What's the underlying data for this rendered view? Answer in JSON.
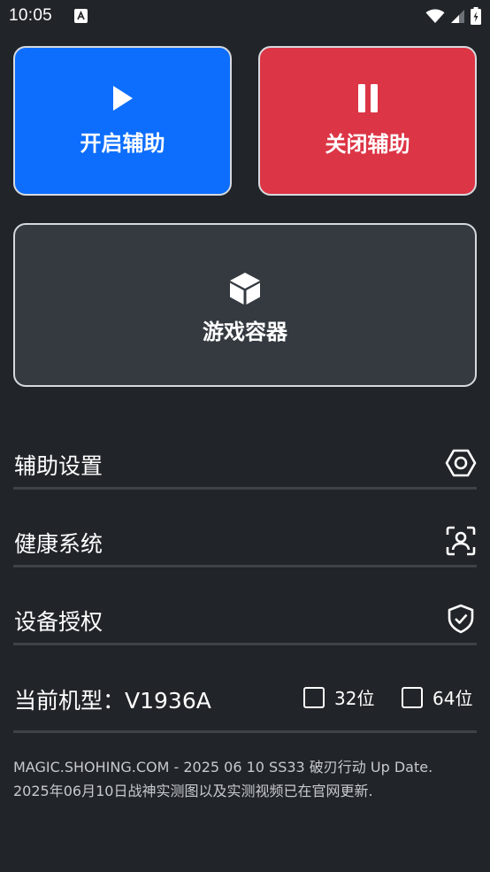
{
  "status_bar": {
    "time": "10:05",
    "icons": [
      "notification-icon",
      "wifi-icon",
      "signal-icon",
      "battery-charging-icon"
    ]
  },
  "buttons": {
    "open": {
      "label": "开启辅助",
      "icon": "play-icon",
      "color": "#0d6efd"
    },
    "close": {
      "label": "关闭辅助",
      "icon": "pause-icon",
      "color": "#dc3545"
    },
    "container": {
      "label": "游戏容器",
      "icon": "cube-icon",
      "color": "#343a40"
    }
  },
  "menu": {
    "items": [
      {
        "label": "辅助设置",
        "icon": "hexagon-settings-icon"
      },
      {
        "label": "健康系统",
        "icon": "user-scan-icon"
      },
      {
        "label": "设备授权",
        "icon": "shield-check-icon"
      }
    ]
  },
  "device": {
    "model_label": "当前机型：V1936A",
    "options": [
      {
        "label": "32位",
        "checked": false
      },
      {
        "label": "64位",
        "checked": false
      }
    ]
  },
  "footer": {
    "line1": "MAGIC.SHOHING.COM - 2025 06 10 SS33 破刃行动 Up Date.",
    "line2": "2025年06月10日战神实测图以及实测视频已在官网更新."
  }
}
